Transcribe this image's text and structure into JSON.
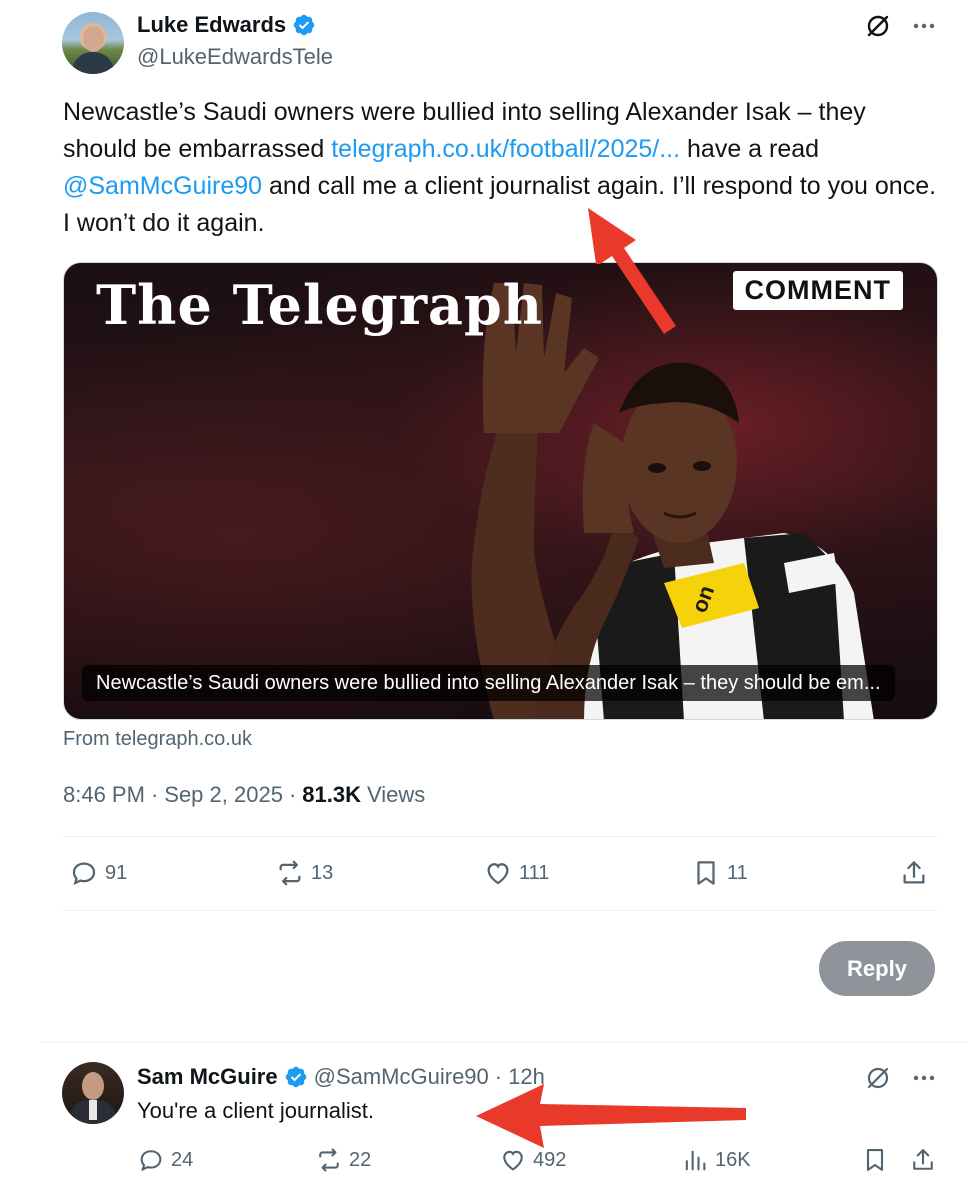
{
  "tweet": {
    "author": {
      "name": "Luke Edwards",
      "handle": "@LukeEdwardsTele",
      "verified": true
    },
    "text_parts": {
      "before_link": "Newcastle’s Saudi owners were bullied into selling Alexander Isak – they should be embarrassed ",
      "link": "telegraph.co.uk/football/2025/...",
      "after_link": " have a read ",
      "mention": "@SamMcGuire90",
      "after_mention": " and call me a client journalist again. I’ll respond to you once. I won’t do it again."
    },
    "card": {
      "logo": "The Telegraph",
      "badge": "COMMENT",
      "caption": "Newcastle’s Saudi owners were bullied into selling Alexander Isak – they should be em...",
      "source": "From telegraph.co.uk",
      "shirt_text": "on"
    },
    "time": "8:46 PM",
    "date": "Sep 2, 2025",
    "separator": "·",
    "views_count": "81.3K",
    "views_label": "Views",
    "stats": {
      "replies": "91",
      "reposts": "13",
      "likes": "111",
      "bookmarks": "11"
    },
    "reply_button": "Reply"
  },
  "reply": {
    "author": {
      "name": "Sam McGuire",
      "handle": "@SamMcGuire90",
      "verified": true
    },
    "separator": "·",
    "time": "12h",
    "text": "You're a client journalist.",
    "stats": {
      "replies": "24",
      "reposts": "22",
      "likes": "492",
      "views": "16K"
    }
  },
  "icons": {
    "grok": "grok-icon",
    "more": "more-icon",
    "reply": "reply-icon",
    "repost": "repost-icon",
    "like": "like-icon",
    "bookmark": "bookmark-icon",
    "share": "share-icon",
    "views": "views-icon",
    "verified": "verified-badge-icon"
  },
  "colors": {
    "link": "#1d9bf0",
    "verified": "#1d9bf0",
    "secondary_text": "#536471",
    "annotation_arrow": "#e8392b",
    "reply_button_bg": "#8e9499"
  }
}
